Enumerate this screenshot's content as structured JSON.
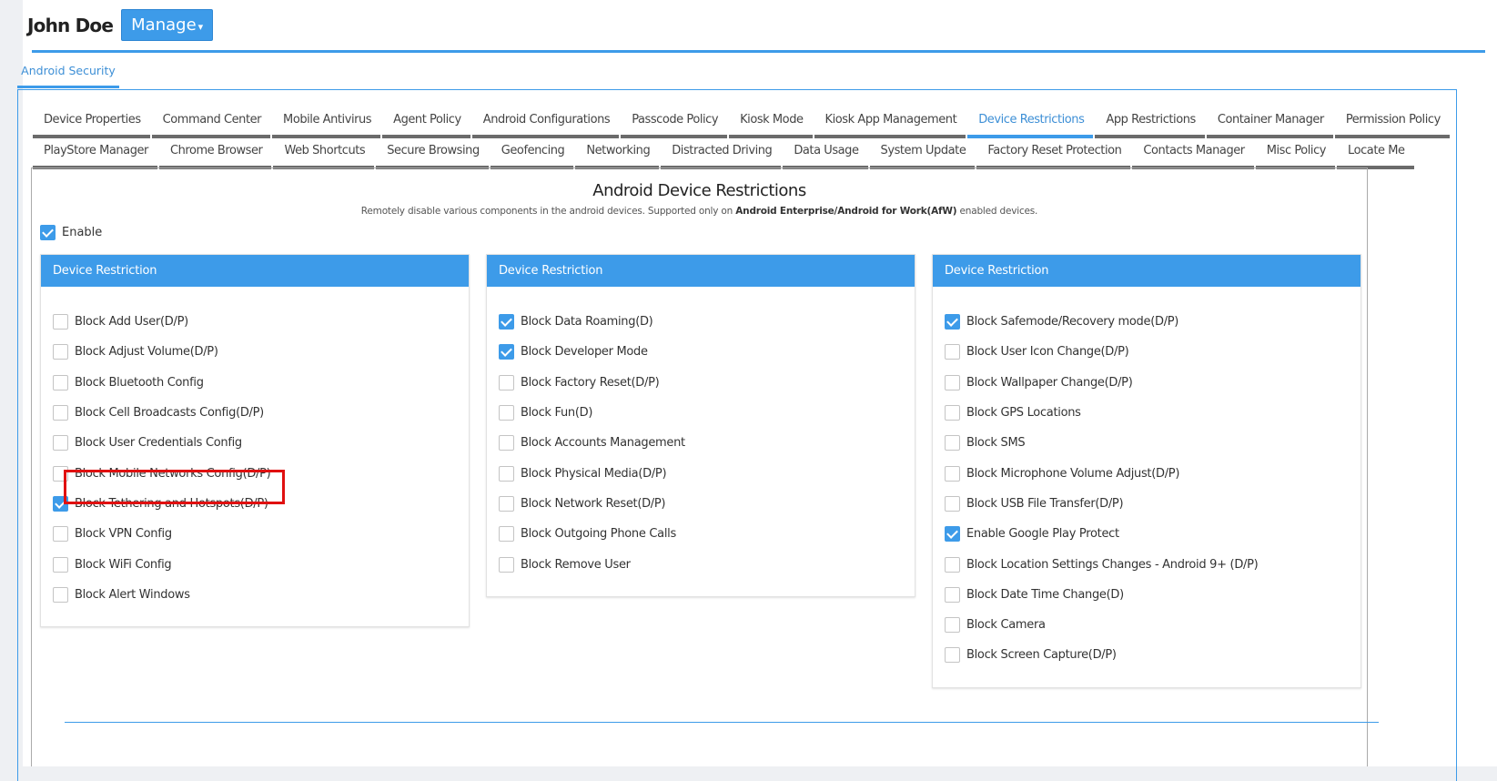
{
  "header": {
    "user_name": "John Doe",
    "manage_label": "Manage",
    "caret": "▾"
  },
  "top_tab": "Android Security",
  "subtabs_row1": [
    {
      "label": "Device Properties",
      "active": false
    },
    {
      "label": "Command Center",
      "active": false
    },
    {
      "label": "Mobile Antivirus",
      "active": false
    },
    {
      "label": "Agent Policy",
      "active": false
    },
    {
      "label": "Android Configurations",
      "active": false
    },
    {
      "label": "Passcode Policy",
      "active": false
    },
    {
      "label": "Kiosk Mode",
      "active": false
    },
    {
      "label": "Kiosk App Management",
      "active": false
    },
    {
      "label": "Device Restrictions",
      "active": true
    },
    {
      "label": "App Restrictions",
      "active": false
    },
    {
      "label": "Container Manager",
      "active": false
    },
    {
      "label": "Permission Policy",
      "active": false
    }
  ],
  "subtabs_row2": [
    {
      "label": "PlayStore Manager",
      "active": false
    },
    {
      "label": "Chrome Browser",
      "active": false
    },
    {
      "label": "Web Shortcuts",
      "active": false
    },
    {
      "label": "Secure Browsing",
      "active": false
    },
    {
      "label": "Geofencing",
      "active": false
    },
    {
      "label": "Networking",
      "active": false
    },
    {
      "label": "Distracted Driving",
      "active": false
    },
    {
      "label": "Data Usage",
      "active": false
    },
    {
      "label": "System Update",
      "active": false
    },
    {
      "label": "Factory Reset Protection",
      "active": false
    },
    {
      "label": "Contacts Manager",
      "active": false
    },
    {
      "label": "Misc Policy",
      "active": false
    },
    {
      "label": "Locate Me",
      "active": false
    }
  ],
  "content": {
    "title": "Android Device Restrictions",
    "desc_pre": "Remotely disable various components in the android devices. Supported only on ",
    "desc_bold": "Android Enterprise/Android for Work(AfW)",
    "desc_post": " enabled devices.",
    "enable_label": "Enable",
    "enable_checked": true
  },
  "panels": [
    {
      "title": "Device Restriction",
      "items": [
        {
          "label": "Block Add User(D/P)",
          "checked": false
        },
        {
          "label": "Block Adjust Volume(D/P)",
          "checked": false
        },
        {
          "label": "Block Bluetooth Config",
          "checked": false
        },
        {
          "label": "Block Cell Broadcasts Config(D/P)",
          "checked": false
        },
        {
          "label": "Block User Credentials Config",
          "checked": false
        },
        {
          "label": "Block Mobile Networks Config(D/P)",
          "checked": false
        },
        {
          "label": "Block Tethering and Hotspots(D/P)",
          "checked": true
        },
        {
          "label": "Block VPN Config",
          "checked": false
        },
        {
          "label": "Block WiFi Config",
          "checked": false
        },
        {
          "label": "Block Alert Windows",
          "checked": false
        }
      ]
    },
    {
      "title": "Device Restriction",
      "items": [
        {
          "label": "Block Data Roaming(D)",
          "checked": true
        },
        {
          "label": "Block Developer Mode",
          "checked": true
        },
        {
          "label": "Block Factory Reset(D/P)",
          "checked": false
        },
        {
          "label": "Block Fun(D)",
          "checked": false
        },
        {
          "label": "Block Accounts Management",
          "checked": false
        },
        {
          "label": "Block Physical Media(D/P)",
          "checked": false
        },
        {
          "label": "Block Network Reset(D/P)",
          "checked": false
        },
        {
          "label": "Block Outgoing Phone Calls",
          "checked": false
        },
        {
          "label": "Block Remove User",
          "checked": false
        }
      ]
    },
    {
      "title": "Device Restriction",
      "items": [
        {
          "label": "Block Safemode/Recovery mode(D/P)",
          "checked": true
        },
        {
          "label": "Block User Icon Change(D/P)",
          "checked": false
        },
        {
          "label": "Block Wallpaper Change(D/P)",
          "checked": false
        },
        {
          "label": "Block GPS Locations",
          "checked": false
        },
        {
          "label": "Block SMS",
          "checked": false
        },
        {
          "label": "Block Microphone Volume Adjust(D/P)",
          "checked": false
        },
        {
          "label": "Block USB File Transfer(D/P)",
          "checked": false
        },
        {
          "label": "Enable Google Play Protect",
          "checked": true
        },
        {
          "label": "Block Location Settings Changes - Android 9+ (D/P)",
          "checked": false
        },
        {
          "label": "Block Date Time Change(D)",
          "checked": false
        },
        {
          "label": "Block Camera",
          "checked": false
        },
        {
          "label": "Block Screen Capture(D/P)",
          "checked": false
        }
      ]
    }
  ],
  "colors": {
    "accent": "#3d9be9",
    "highlight": "#e01010"
  }
}
